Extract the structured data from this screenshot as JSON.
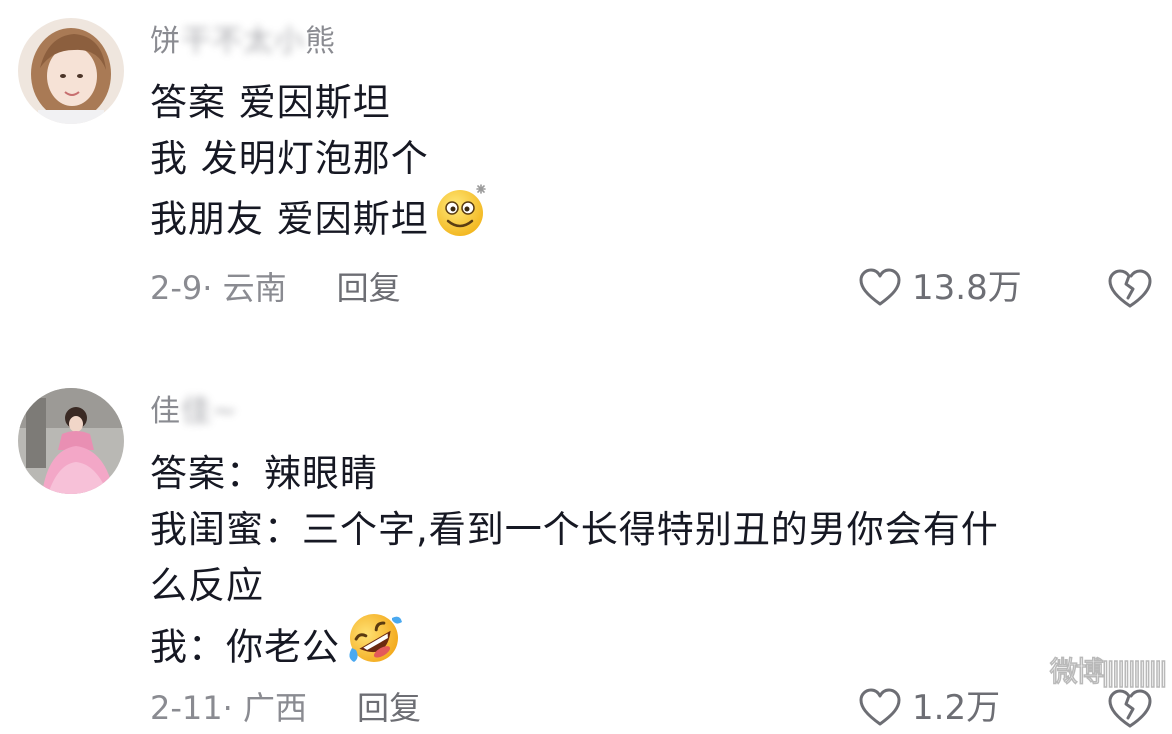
{
  "comments": [
    {
      "username_visible_prefix": "饼",
      "username_blurred": "干不太小",
      "username_visible_suffix": "熊",
      "lines": [
        "答案  爱因斯坦",
        "我  发明灯泡那个",
        "我朋友  爱因斯坦"
      ],
      "emoji": "dizzy-smile-emoji",
      "date_location": "2-9· 云南",
      "reply_label": "回复",
      "like_count": "13.8万"
    },
    {
      "username_visible_prefix": "佳",
      "username_blurred": "佳~",
      "username_visible_suffix": "",
      "lines": [
        "答案：辣眼睛",
        "我闺蜜：三个字,看到一个长得特别丑的男你会有什",
        "么反应",
        "我：你老公"
      ],
      "emoji": "rofl-emoji",
      "date_location": "2-11· 广西",
      "reply_label": "回复",
      "like_count": "1.2万"
    }
  ],
  "watermark": "微博||||||||||||",
  "icons": {
    "like": "heart-outline-icon",
    "dislike": "broken-heart-icon"
  },
  "colors": {
    "text": "#161823",
    "meta": "#8a8b91",
    "background": "#ffffff"
  }
}
